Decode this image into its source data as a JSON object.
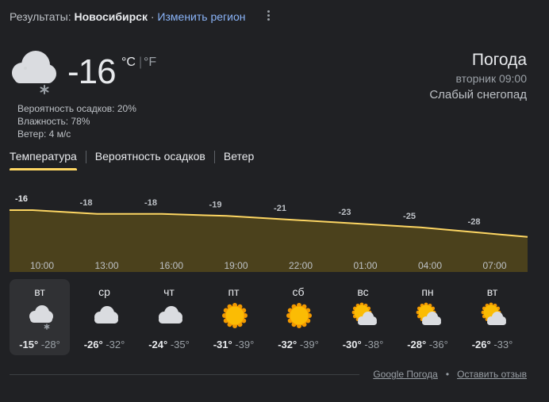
{
  "header": {
    "results_label": "Результаты:",
    "city": "Новосибирск",
    "separator": "·",
    "change_region": "Изменить регион"
  },
  "current": {
    "icon": "cloud-snow-icon",
    "temperature": "-16",
    "unit_c": "°C",
    "unit_sep": "|",
    "unit_f": "°F",
    "precip": "Вероятность осадков: 20%",
    "humidity": "Влажность: 78%",
    "wind": "Ветер: 4 м/с"
  },
  "summary": {
    "title": "Погода",
    "day_time": "вторник 09:00",
    "condition": "Слабый снегопад"
  },
  "tabs": [
    {
      "label": "Температура",
      "active": true
    },
    {
      "label": "Вероятность осадков",
      "active": false
    },
    {
      "label": "Ветер",
      "active": false
    }
  ],
  "chart_data": {
    "type": "area",
    "series": [
      {
        "values": [
          -16,
          -18,
          -18,
          -19,
          -21,
          -23,
          -25,
          -28
        ]
      }
    ],
    "labels": [
      "-16",
      "-18",
      "-18",
      "-19",
      "-21",
      "-23",
      "-25",
      "-28"
    ],
    "times": [
      "10:00",
      "13:00",
      "16:00",
      "19:00",
      "22:00",
      "01:00",
      "04:00",
      "07:00"
    ],
    "line_color": "#fdd663",
    "fill_color": "#4b411c"
  },
  "days": [
    {
      "name": "вт",
      "icon": "cloud-snow-icon",
      "hi": "-15°",
      "lo": "-28°",
      "selected": true
    },
    {
      "name": "ср",
      "icon": "cloud-icon",
      "hi": "-26°",
      "lo": "-32°",
      "selected": false
    },
    {
      "name": "чт",
      "icon": "cloud-icon",
      "hi": "-24°",
      "lo": "-35°",
      "selected": false
    },
    {
      "name": "пт",
      "icon": "sun-icon",
      "hi": "-31°",
      "lo": "-39°",
      "selected": false
    },
    {
      "name": "сб",
      "icon": "sun-icon",
      "hi": "-32°",
      "lo": "-39°",
      "selected": false
    },
    {
      "name": "вс",
      "icon": "partly-cloudy-icon",
      "hi": "-30°",
      "lo": "-38°",
      "selected": false
    },
    {
      "name": "пн",
      "icon": "partly-cloudy-icon",
      "hi": "-28°",
      "lo": "-36°",
      "selected": false
    },
    {
      "name": "вт",
      "icon": "partly-cloudy-icon",
      "hi": "-26°",
      "lo": "-33°",
      "selected": false
    }
  ],
  "footer": {
    "google_weather": "Google Погода",
    "dot": "•",
    "feedback": "Оставить отзыв"
  }
}
